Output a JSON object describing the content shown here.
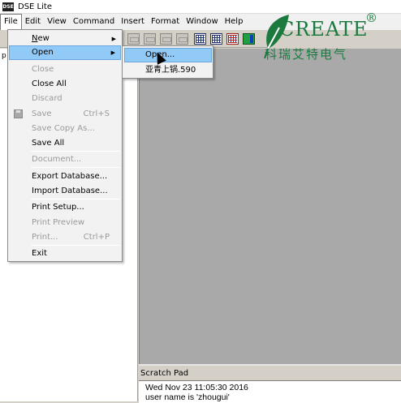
{
  "window": {
    "title": "DSE Lite",
    "icon_text": "DSE"
  },
  "menubar": {
    "items": [
      {
        "label": "File"
      },
      {
        "label": "Edit"
      },
      {
        "label": "View"
      },
      {
        "label": "Command"
      },
      {
        "label": "Insert"
      },
      {
        "label": "Format"
      },
      {
        "label": "Window"
      },
      {
        "label": "Help"
      }
    ]
  },
  "leftpane": {
    "tab_label": "p"
  },
  "file_menu": {
    "new": "New",
    "open": "Open",
    "close": "Close",
    "close_all": "Close All",
    "discard": "Discard",
    "save": "Save",
    "save_shortcut": "Ctrl+S",
    "save_copy_as": "Save Copy As...",
    "save_all": "Save All",
    "document": "Document...",
    "export_database": "Export Database...",
    "import_database": "Import Database...",
    "print_setup": "Print Setup...",
    "print_preview": "Print Preview",
    "print": "Print...",
    "print_shortcut": "Ctrl+P",
    "exit": "Exit"
  },
  "open_submenu": {
    "open": "Open...",
    "recent_1": "亚青上锅.590"
  },
  "scratch_pad": {
    "title": "Scratch Pad",
    "line1": "Wed Nov 23 11:05:30 2016",
    "line2": "user name is 'zhougui'"
  },
  "logo": {
    "word": "CREATE",
    "registered": "®",
    "chinese": "科瑞艾特电气",
    "color": "#1d7a3f"
  }
}
